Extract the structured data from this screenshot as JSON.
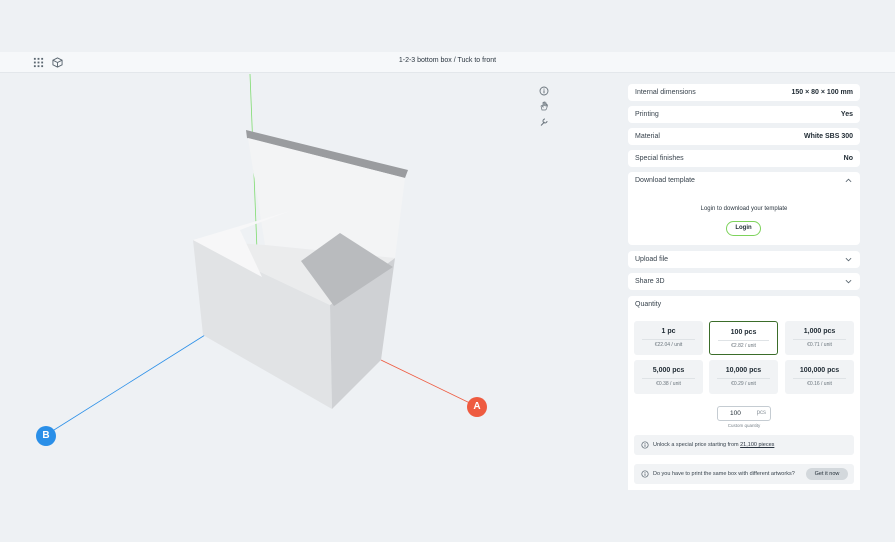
{
  "header": {
    "title": "1-2-3 bottom box / Tuck to front"
  },
  "viewer": {
    "axis_a_label": "A",
    "axis_b_label": "B",
    "colors": {
      "axis_a": "#ee5b40",
      "axis_b": "#2a8fe8",
      "axis_green": "#7fdc70"
    }
  },
  "specs": [
    {
      "label": "Internal dimensions",
      "value": "150 × 80 × 100 mm"
    },
    {
      "label": "Printing",
      "value": "Yes"
    },
    {
      "label": "Material",
      "value": "White SBS 300"
    },
    {
      "label": "Special finishes",
      "value": "No"
    }
  ],
  "download": {
    "label": "Download template",
    "message": "Login to download your template",
    "login_button": "Login"
  },
  "upload": {
    "label": "Upload file"
  },
  "share": {
    "label": "Share 3D"
  },
  "quantity": {
    "label": "Quantity",
    "options": [
      {
        "qty": "1 pc",
        "price": "€22.04 / unit"
      },
      {
        "qty": "100 pcs",
        "price": "€2.82 / unit",
        "selected": true
      },
      {
        "qty": "1,000 pcs",
        "price": "€0.71 / unit"
      },
      {
        "qty": "5,000 pcs",
        "price": "€0.38 / unit"
      },
      {
        "qty": "10,000 pcs",
        "price": "€0.29 / unit"
      },
      {
        "qty": "100,000 pcs",
        "price": "€0.16 / unit"
      }
    ],
    "custom_value": "100",
    "custom_unit": "pcs",
    "custom_label": "Custom quantity"
  },
  "special_price": {
    "text": "Unlock a special price starting from ",
    "link": "21,100 pieces"
  },
  "artworks": {
    "text": "Do you have to print the same box with different artworks?",
    "button": "Get it now"
  }
}
